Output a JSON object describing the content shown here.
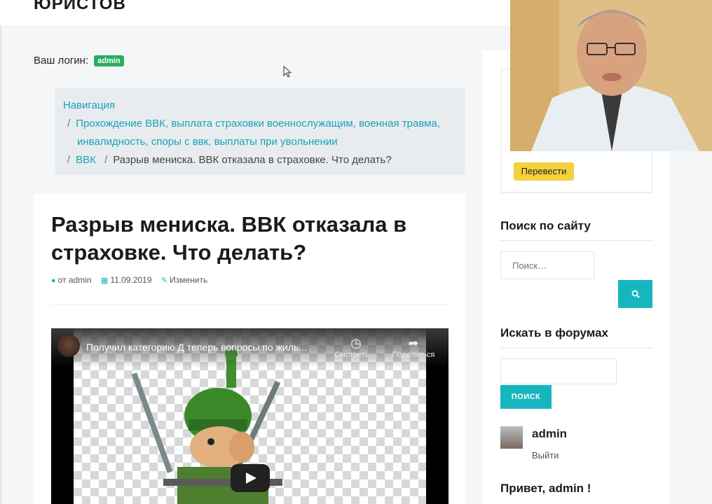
{
  "header": {
    "site_title": "юристов"
  },
  "login": {
    "label": "Ваш логин:",
    "badge": "admin"
  },
  "breadcrumb": {
    "nav_label": "Навигация",
    "separator": "/",
    "item1_line1": "Прохождение ВВК, выплата страховки военнослужащим, военная травма,",
    "item1_line2": "инвалидность, споры с ввк, выплаты при увольнении",
    "item2": "ВВК",
    "current": "Разрыв мениска. ВВК отказала в страховке. Что делать?"
  },
  "article": {
    "title": "Разрыв мениска. ВВК отказала в страховке. Что делать?",
    "meta_author": "от admin",
    "meta_date": "11.09.2019",
    "meta_edit": "Изменить"
  },
  "video": {
    "title": "Получил категорию Д теперь вопросы по жиль...",
    "watch_later": "Смотреть ...",
    "share": "Поделиться"
  },
  "sidebar": {
    "translate_button": "Перевести",
    "search_heading": "Поиск по сайту",
    "search_placeholder": "Поиск…",
    "forum_heading": "Искать в форумах",
    "forum_button": "ПОИСК",
    "user_name": "admin",
    "logout": "Выйти",
    "greeting": "Привет, admin !"
  },
  "colors": {
    "accent": "#17b6bf",
    "link": "#17a2b8",
    "badge": "#27ae60",
    "translate_button": "#f4d13d"
  }
}
